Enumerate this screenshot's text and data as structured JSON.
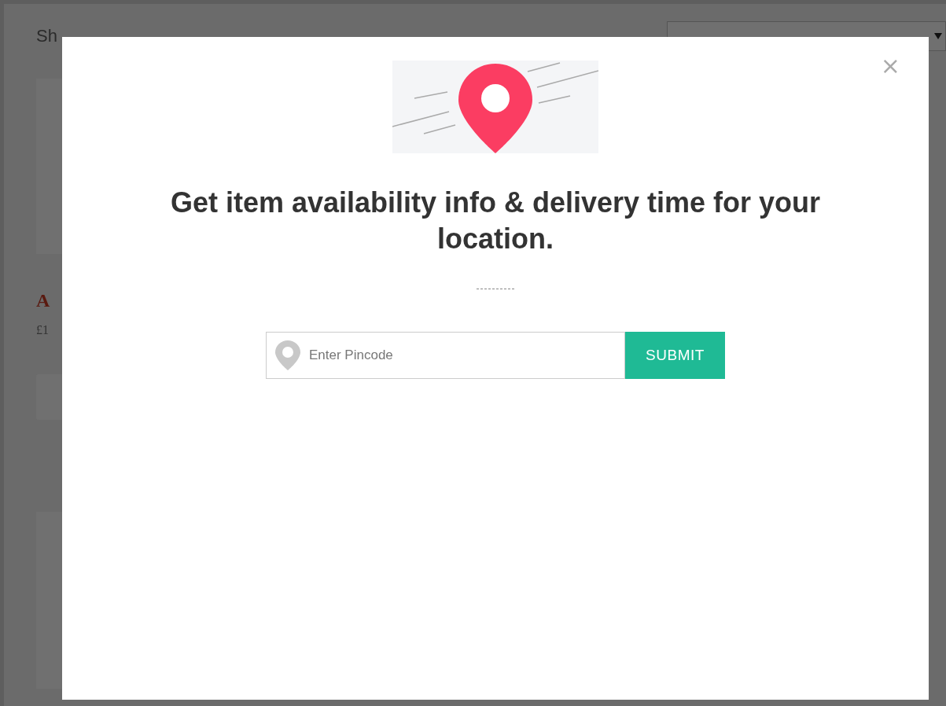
{
  "backdrop": {
    "results_text": "Sh",
    "product_title": "A",
    "product_price": "£1"
  },
  "modal": {
    "heading": "Get item availability info & delivery time for your location.",
    "pincode_field": {
      "placeholder": "Enter Pincode"
    },
    "submit_label": "SUBMIT",
    "close_label": "×"
  }
}
